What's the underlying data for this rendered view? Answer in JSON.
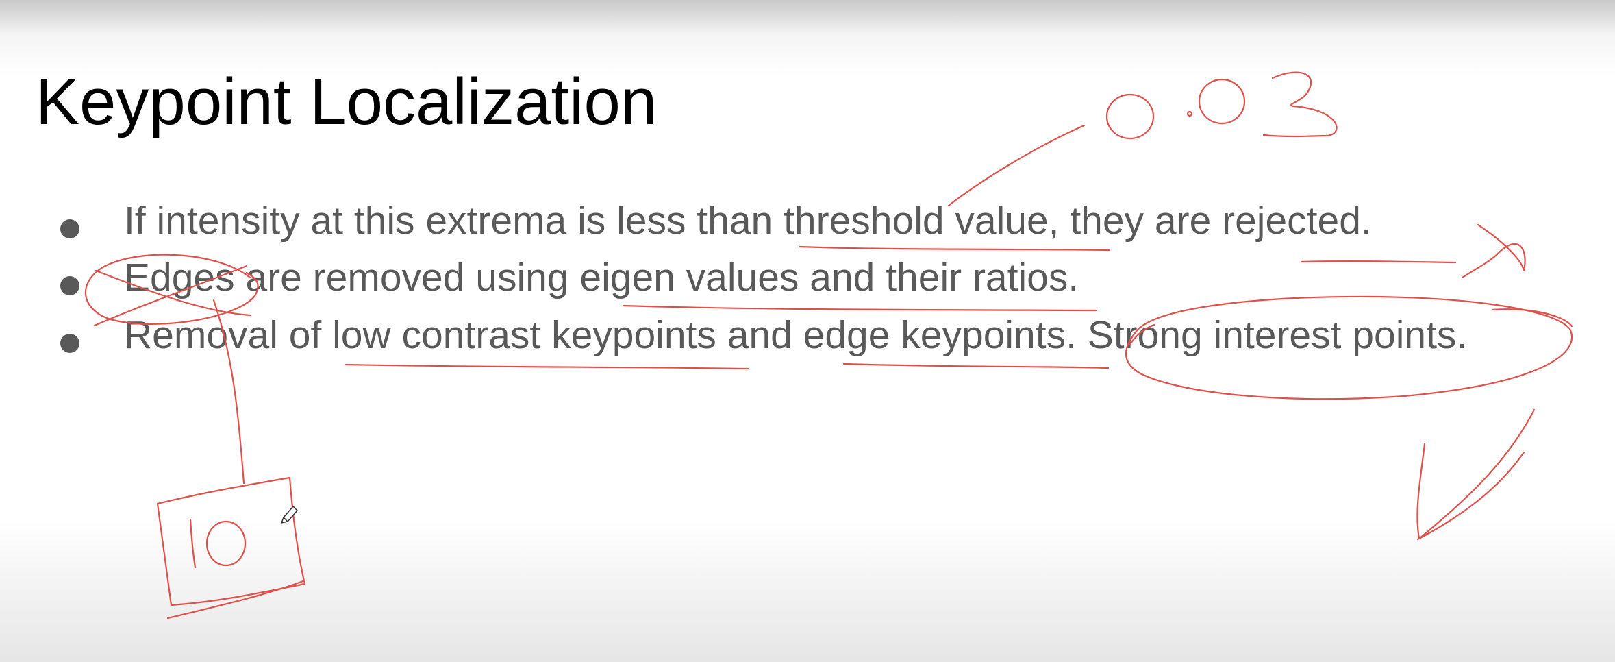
{
  "slide": {
    "title": "Keypoint Localization",
    "bullets": [
      "If intensity at this extrema is less than threshold value, they are rejected.",
      "Edges are removed using eigen values and their ratios.",
      "Removal of low contrast keypoints and edge keypoints. Strong interest points."
    ]
  },
  "annotations": {
    "ink_color": "#e0504b",
    "threshold_note": "0.03",
    "box_note": "10",
    "marks": [
      "cross-mark-icon",
      "check-mark-icon",
      "pencil-cursor-icon"
    ]
  }
}
